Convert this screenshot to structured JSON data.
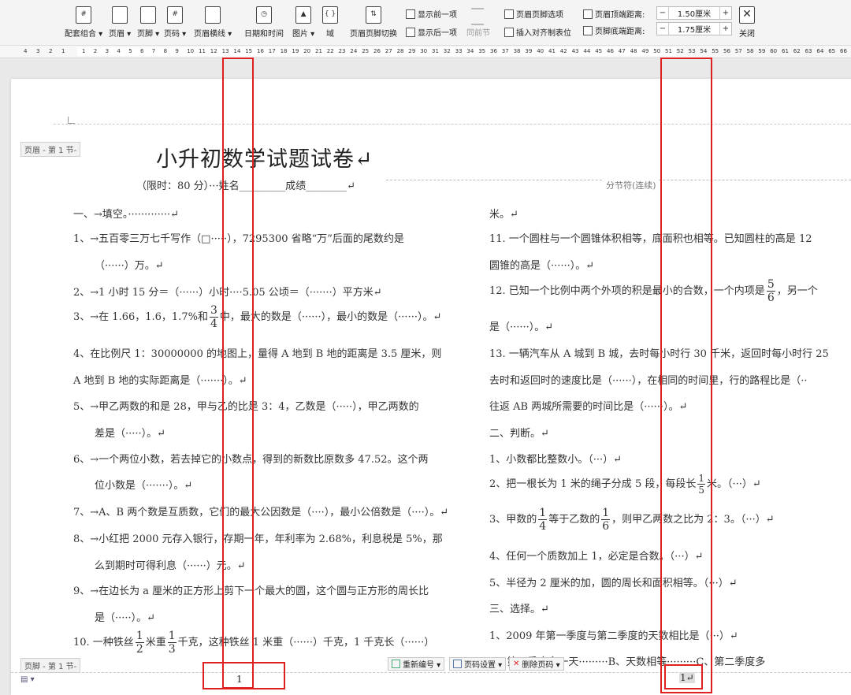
{
  "toolbar": {
    "buttons": [
      {
        "label": "配套组合 ▾",
        "glyph": "#"
      },
      {
        "label": "页眉 ▾",
        "glyph": ""
      },
      {
        "label": "页脚 ▾",
        "glyph": ""
      },
      {
        "label": "页码 ▾",
        "glyph": "#"
      },
      {
        "label": "页眉横线 ▾",
        "glyph": ""
      },
      {
        "label": "日期和时间",
        "glyph": "◷"
      },
      {
        "label": "图片 ▾",
        "glyph": "▲"
      },
      {
        "label": "域",
        "glyph": "{ }"
      },
      {
        "label": "页眉页脚切换",
        "glyph": "⇅"
      }
    ],
    "show_prev": "显示前一项",
    "show_next": "显示后一项",
    "same_as_prev": "同前节",
    "hf_options": "页眉页脚选项",
    "insert_align_tab": "插入对齐制表位",
    "header_top_label": "页眉顶端距离:",
    "header_top_value": "1.50厘米",
    "footer_bottom_label": "页脚底端距离:",
    "footer_bottom_value": "1.75厘米",
    "minus": "−",
    "plus": "+",
    "close": "关闭"
  },
  "ruler": {
    "left": [
      "4",
      "3",
      "2",
      "1"
    ],
    "nums": [
      "1",
      "2",
      "3",
      "4",
      "5",
      "6",
      "7",
      "8",
      "9",
      "10",
      "11",
      "12",
      "13",
      "14",
      "15",
      "16",
      "17",
      "18",
      "19",
      "20",
      "21",
      "22",
      "23",
      "24",
      "25",
      "26",
      "27",
      "28",
      "29",
      "30",
      "31",
      "32",
      "33",
      "34",
      "35",
      "36",
      "37",
      "38",
      "39",
      "40",
      "41",
      "42",
      "43",
      "44",
      "45",
      "46",
      "47",
      "48",
      "49",
      "50",
      "51",
      "52",
      "53",
      "54",
      "55",
      "56",
      "57",
      "58",
      "59",
      "60",
      "61",
      "62",
      "63",
      "64",
      "65",
      "66"
    ]
  },
  "doc": {
    "header_tag": "页眉 - 第 1 节-",
    "footer_tag": "页脚 - 第 1 节-",
    "title": "小升初数学试题试卷↵",
    "subtitle": "（限时：80 分）···姓名_________成绩________↵",
    "section_break": "分节符(连续)",
    "left": [
      "一、→填空。·············↵",
      "1、→五百零三万七千写作（□·····），7295300 省略“万”后面的尾数约是",
      "（······）万。↵",
      "2、→1 小时 15 分＝（······）小时····5.05 公顷＝（·······）平方米↵",
      "3、→在 1.66，1.6，1.7%和",
      "中，最大的数是（······），最小的数是（······）。↵",
      "4、在比例尺 1：30000000 的地图上，量得 A 地到 B 地的距离是 3.5 厘米，则",
      "A 地到 B 地的实际距离是（·······）。↵",
      "5、→甲乙两数的和是 28，甲与乙的比是 3：4，乙数是（·····），甲乙两数的",
      "差是（·····）。↵",
      "6、→一个两位小数，若去掉它的小数点，得到的新数比原数多 47.52。这个两",
      "位小数是（·······）。↵",
      "7、→A、B 两个数是互质数，它们的最大公因数是（····），最小公倍数是（····）。↵",
      "8、→小红把 2000 元存入银行，存期一年，年利率为 2.68%，利息税是 5%，那",
      "么到期时可得利息（······）元。↵",
      "9、→在边长为 a 厘米的正方形上剪下一个最大的圆，这个圆与正方形的周长比",
      "是（·····）。↵",
      "10. 一种铁丝",
      "米重",
      "千克，这种铁丝 1 米重（······）千克，1 千克长（······）"
    ],
    "right": [
      "米。↵",
      "11. 一个圆柱与一个圆锥体积相等，底面积也相等。已知圆柱的高是 12",
      "圆锥的高是（······）。↵",
      "12. 已知一个比例中两个外项的积是最小的合数，一个内项是",
      "，另一个",
      "是（······）。↵",
      "13. 一辆汽车从 A 城到 B 城，去时每小时行 30 千米，返回时每小时行 25",
      "去时和返回时的速度比是（······），在相同的时间里，行的路程比是（··",
      "往返 AB 两城所需要的时间比是（······）。↵",
      "二、判断。↵",
      "1、小数都比整数小。（···）↵",
      "2、把一根长为 1 米的绳子分成 5 段，每段长",
      "米。（···）↵",
      "3、甲数的",
      "等于乙数的",
      "，则甲乙两数之比为 2：3。（···）↵",
      "4、任何一个质数加上 1，必定是合数。（···）↵",
      "5、半径为 2 厘米的加，圆的周长和面积相等。（···）↵",
      "三、选择。↵",
      "1、2009 年第一季度与第二季度的天数相比是（···）↵",
      "A、第一季度多一天·········B、天数相等·········C、第二季度多"
    ],
    "fractions": {
      "three_fourths": {
        "n": "3",
        "d": "4"
      },
      "one_half": {
        "n": "1",
        "d": "2"
      },
      "one_third": {
        "n": "1",
        "d": "3"
      },
      "five_sixths": {
        "n": "5",
        "d": "6"
      },
      "one_fifth": {
        "n": "1",
        "d": "5"
      },
      "one_fourth": {
        "n": "1",
        "d": "4"
      },
      "one_sixth": {
        "n": "1",
        "d": "6"
      }
    },
    "footer_buttons": {
      "renumber": "重新编号 ▾",
      "page_setup": "页码设置 ▾",
      "delete_page_num": "删除页码 ▾"
    },
    "page_number_left": "1",
    "page_number_right": "1↵",
    "accent_red": "#e02020"
  }
}
